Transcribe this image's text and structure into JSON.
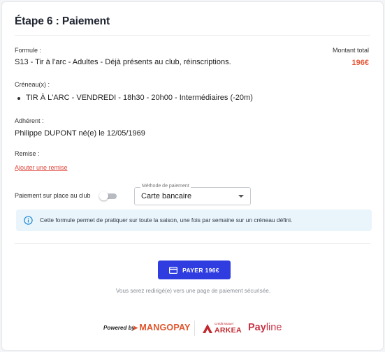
{
  "step_title": "Étape 6 : Paiement",
  "formule": {
    "label": "Formule :",
    "value": "S13 - Tir à l'arc - Adultes - Déjà présents au club, réinscriptions."
  },
  "montant": {
    "label": "Montant total",
    "value": "196€",
    "color": "#e85a3c"
  },
  "creneaux": {
    "label": "Créneau(x) :",
    "items": [
      "TIR À L'ARC - VENDREDI - 18h30 - 20h00 - Intermédiaires (-20m)"
    ]
  },
  "adherent": {
    "label": "Adhérent :",
    "value": "Philippe DUPONT né(e) le 12/05/1969"
  },
  "remise": {
    "label": "Remise :",
    "link": "Ajouter une remise"
  },
  "paiement_place": {
    "label": "Paiement sur place au club",
    "enabled": false
  },
  "methode": {
    "legend": "Méthode de paiement",
    "value": "Carte bancaire"
  },
  "info": {
    "icon": "info-icon",
    "text": "Cette formule permet de pratiquer sur toute la saison, une fois par semaine sur un créneau défini."
  },
  "pay_button": {
    "icon": "credit-card-icon",
    "label": "PAYER 196€",
    "color": "#2f3de0"
  },
  "redirect_note": "Vous serez redirigé(e) vers une page de paiement sécurisée.",
  "footer": {
    "powered_by": "Powered by",
    "mangopay": "MANGOPAY",
    "arkea_small": "Crédit Mutuel",
    "arkea": "ARKEA",
    "payline_a": "Pay",
    "payline_b": "line"
  }
}
